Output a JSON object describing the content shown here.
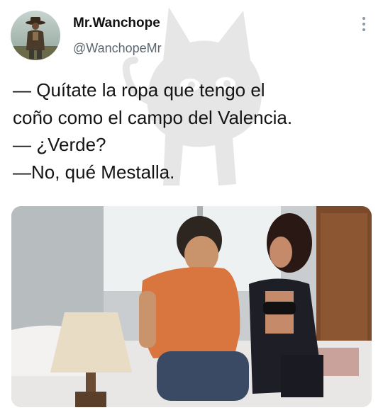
{
  "author": {
    "display_name": "Mr.Wanchope",
    "handle": "@WanchopeMr",
    "avatar_icon": "cowboy-avatar"
  },
  "tweet": {
    "lines": [
      "— Quítate la ropa que tengo el",
      "coño como el campo del Valencia.",
      "— ¿Verde?",
      "—No, qué Mestalla."
    ]
  },
  "media": {
    "description_icon": "photo-couple-on-bed"
  },
  "colors": {
    "text": "#141414",
    "handle": "#5b6670",
    "watermark": "#e4e4e4"
  }
}
